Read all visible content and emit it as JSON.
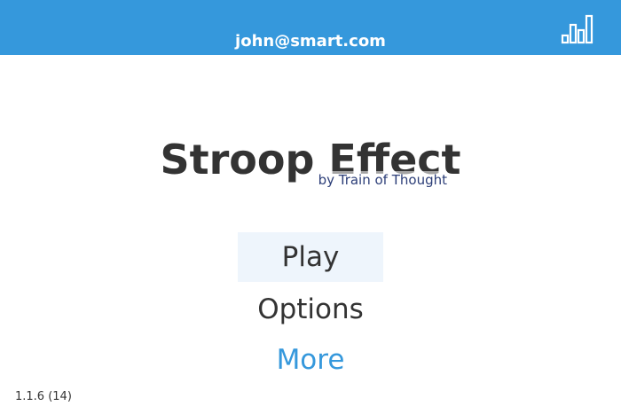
{
  "header": {
    "user_email": "john@smart.com",
    "stats_icon": "bar-chart-icon",
    "background_color": "#3598dc"
  },
  "title_block": {
    "title": "Stroop Effect",
    "subtitle": "by Train of Thought"
  },
  "menu": {
    "play_label": "Play",
    "options_label": "Options",
    "more_label": "More",
    "more_color": "#3598dc",
    "selected": "Play"
  },
  "footer": {
    "version": "1.1.6 (14)"
  }
}
